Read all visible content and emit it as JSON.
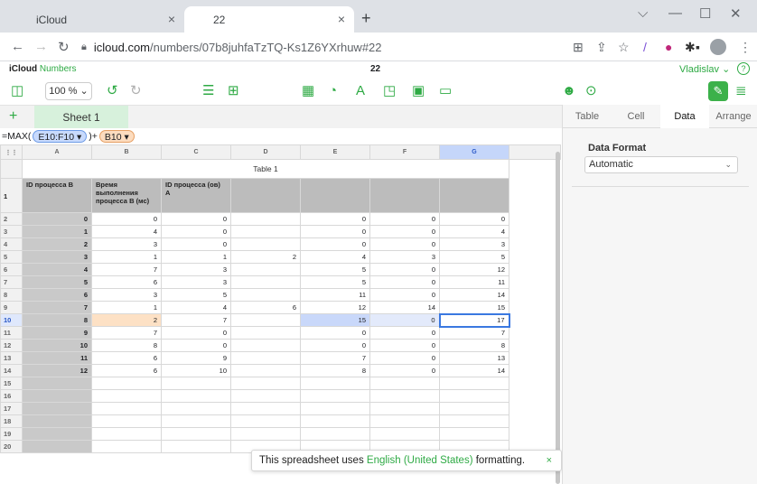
{
  "browser": {
    "tabs": [
      {
        "title": "iCloud",
        "icon": "apple-icon",
        "close": "×"
      },
      {
        "title": "22",
        "icon": "apple-icon",
        "close": "×"
      }
    ],
    "new_tab": "+",
    "window_controls": {
      "dropdown": "⌵",
      "minimize": "—",
      "maximize": "☐",
      "close": "✕"
    },
    "url_domain": "icloud.com",
    "url_path": "/numbers/07b8juhfaTzTQ-Ks1Z6YXrhuw#22"
  },
  "app": {
    "brand_bold": "iCloud",
    "brand_light": "Numbers",
    "doc_title": "22",
    "user_name": "Vladislav",
    "help": "?",
    "zoom": "100 %"
  },
  "sheets": {
    "add": "+",
    "active_sheet": "Sheet 1"
  },
  "formula_bar": {
    "prefix": "=MAX(",
    "range_token": "E10:F10 ▾",
    "middle": ")+",
    "cell_token": "B10 ▾"
  },
  "grid": {
    "column_headers": [
      "A",
      "B",
      "C",
      "D",
      "E",
      "F",
      "G"
    ],
    "table_title": "Table 1",
    "header_cells": [
      "ID процесса B",
      "Время выполнения процесса B (мс)",
      "ID процесса (ов) A",
      "",
      "",
      "",
      ""
    ],
    "rows": [
      {
        "n": "2",
        "cells": [
          "0",
          "0",
          "0",
          "",
          "0",
          "0",
          "0"
        ]
      },
      {
        "n": "3",
        "cells": [
          "1",
          "4",
          "0",
          "",
          "0",
          "0",
          "4"
        ]
      },
      {
        "n": "4",
        "cells": [
          "2",
          "3",
          "0",
          "",
          "0",
          "0",
          "3"
        ]
      },
      {
        "n": "5",
        "cells": [
          "3",
          "1",
          "1",
          "2",
          "4",
          "3",
          "5"
        ]
      },
      {
        "n": "6",
        "cells": [
          "4",
          "7",
          "3",
          "",
          "5",
          "0",
          "12"
        ]
      },
      {
        "n": "7",
        "cells": [
          "5",
          "6",
          "3",
          "",
          "5",
          "0",
          "11"
        ]
      },
      {
        "n": "8",
        "cells": [
          "6",
          "3",
          "5",
          "",
          "11",
          "0",
          "14"
        ]
      },
      {
        "n": "9",
        "cells": [
          "7",
          "1",
          "4",
          "6",
          "12",
          "14",
          "15"
        ]
      },
      {
        "n": "10",
        "cells": [
          "8",
          "2",
          "7",
          "",
          "15",
          "0",
          "17"
        ]
      },
      {
        "n": "11",
        "cells": [
          "9",
          "7",
          "0",
          "",
          "0",
          "0",
          "7"
        ]
      },
      {
        "n": "12",
        "cells": [
          "10",
          "8",
          "0",
          "",
          "0",
          "0",
          "8"
        ]
      },
      {
        "n": "13",
        "cells": [
          "11",
          "6",
          "9",
          "",
          "7",
          "0",
          "13"
        ]
      },
      {
        "n": "14",
        "cells": [
          "12",
          "6",
          "10",
          "",
          "8",
          "0",
          "14"
        ]
      },
      {
        "n": "15",
        "cells": [
          "",
          "",
          "",
          "",
          "",
          "",
          ""
        ]
      },
      {
        "n": "16",
        "cells": [
          "",
          "",
          "",
          "",
          "",
          "",
          ""
        ]
      },
      {
        "n": "17",
        "cells": [
          "",
          "",
          "",
          "",
          "",
          "",
          ""
        ]
      },
      {
        "n": "18",
        "cells": [
          "",
          "",
          "",
          "",
          "",
          "",
          ""
        ]
      },
      {
        "n": "19",
        "cells": [
          "",
          "",
          "",
          "",
          "",
          "",
          ""
        ]
      },
      {
        "n": "20",
        "cells": [
          "",
          "",
          "",
          "",
          "",
          "",
          ""
        ]
      }
    ]
  },
  "toast": {
    "before": "This spreadsheet uses ",
    "link": "English (United States)",
    "after": " formatting.",
    "close": "×"
  },
  "panel": {
    "tabs": [
      "Table",
      "Cell",
      "Data",
      "Arrange"
    ],
    "active_tab": "Data",
    "data_format_label": "Data Format",
    "data_format_value": "Automatic"
  },
  "colors": {
    "accent": "#2eaa44",
    "selection": "#3a78e0"
  }
}
